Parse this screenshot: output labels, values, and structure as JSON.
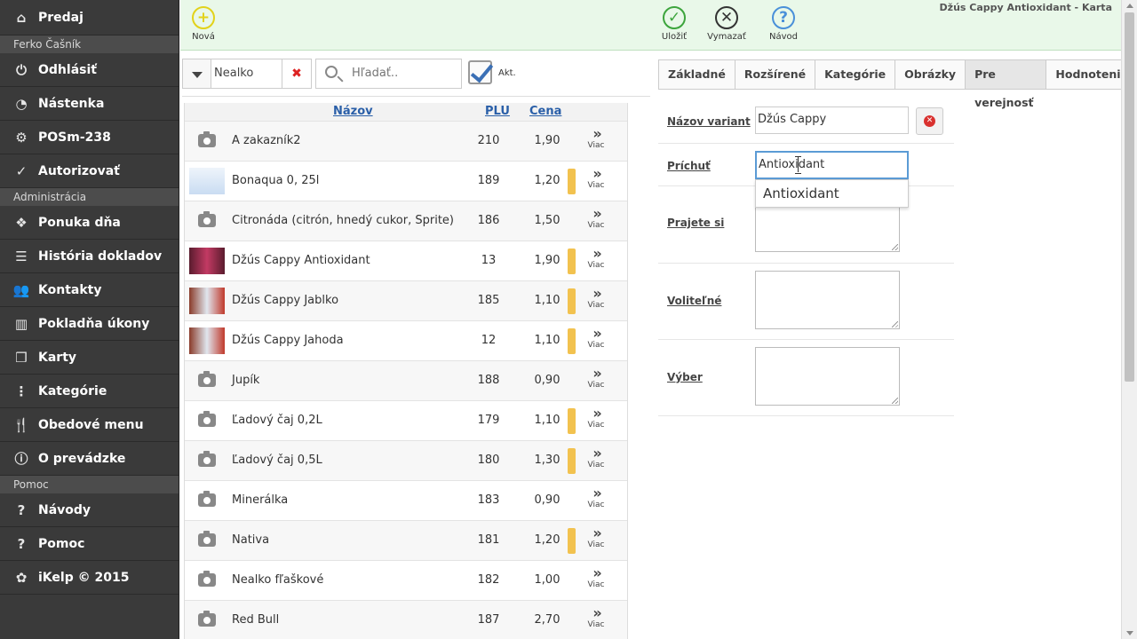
{
  "sidebar": {
    "items": [
      {
        "label": "Predaj",
        "icon": "home-icon",
        "glyph": "⌂"
      },
      {
        "type": "header",
        "label": "Ferko Čašník"
      },
      {
        "label": "Odhlásiť",
        "icon": "power-icon",
        "glyph": "⏻"
      },
      {
        "label": "Nástenka",
        "icon": "dashboard-icon",
        "glyph": "◔"
      },
      {
        "label": "POSm-238",
        "icon": "gear-icon",
        "glyph": "⚙"
      },
      {
        "label": "Autorizovať",
        "icon": "check-circle-icon",
        "glyph": "✓"
      },
      {
        "type": "header",
        "label": "Administrácia"
      },
      {
        "label": "Ponuka dňa",
        "icon": "cubes-star-icon",
        "glyph": "❖"
      },
      {
        "label": "História dokladov",
        "icon": "list-icon",
        "glyph": "☰"
      },
      {
        "label": "Kontakty",
        "icon": "users-icon",
        "glyph": "👥"
      },
      {
        "label": "Pokladňa úkony",
        "icon": "bar-chart-icon",
        "glyph": "▥"
      },
      {
        "label": "Karty",
        "icon": "cubes-icon",
        "glyph": "❒"
      },
      {
        "label": "Kategórie",
        "icon": "tree-icon",
        "glyph": "⋮"
      },
      {
        "label": "Obedové menu",
        "icon": "cutlery-icon",
        "glyph": "🍴"
      },
      {
        "label": "O prevádzke",
        "icon": "info-icon",
        "glyph": "ⓘ"
      },
      {
        "type": "header",
        "label": "Pomoc"
      },
      {
        "label": "Návody",
        "icon": "question-icon",
        "glyph": "?"
      },
      {
        "label": "Pomoc",
        "icon": "question-icon",
        "glyph": "?"
      },
      {
        "label": "iKelp © 2015",
        "icon": "ikelp-logo-icon",
        "glyph": "✿"
      }
    ]
  },
  "toolbar": {
    "new_label": "Nová",
    "save_label": "Uložiť",
    "delete_label": "Vymazať",
    "help_label": "Návod",
    "title": "Džús Cappy Antioxidant - Karta",
    "colors": {
      "new": "#e2d21a",
      "save": "#3da53d",
      "delete": "#333333",
      "help": "#4a90d9"
    }
  },
  "filter": {
    "category_value": "Nealko",
    "search_placeholder": "Hľadať..",
    "active_label": "Akt."
  },
  "table": {
    "headers": {
      "name": "Názov",
      "plu": "PLU",
      "price": "Cena"
    },
    "more_label": "Viac",
    "rows": [
      {
        "name": "A zakazník2",
        "plu": "210",
        "price": "1,90",
        "img": "camera",
        "bar": false
      },
      {
        "name": "Bonaqua 0, 25l",
        "plu": "189",
        "price": "1,20",
        "img": "bonaqua",
        "bar": true
      },
      {
        "name": "Citronáda (citrón, hnedý cukor, Sprite)",
        "plu": "186",
        "price": "1,50",
        "img": "camera",
        "bar": false
      },
      {
        "name": "Džús Cappy Antioxidant",
        "plu": "13",
        "price": "1,90",
        "img": "cappy-dark",
        "bar": true
      },
      {
        "name": "Džús Cappy Jablko",
        "plu": "185",
        "price": "1,10",
        "img": "cappy",
        "bar": true
      },
      {
        "name": "Džús Cappy Jahoda",
        "plu": "12",
        "price": "1,10",
        "img": "cappy",
        "bar": true
      },
      {
        "name": "Jupík",
        "plu": "188",
        "price": "0,90",
        "img": "camera",
        "bar": false
      },
      {
        "name": "Ľadový čaj 0,2L",
        "plu": "179",
        "price": "1,10",
        "img": "camera",
        "bar": true
      },
      {
        "name": "Ľadový čaj 0,5L",
        "plu": "180",
        "price": "1,30",
        "img": "camera",
        "bar": true
      },
      {
        "name": "Minerálka",
        "plu": "183",
        "price": "0,90",
        "img": "camera",
        "bar": false
      },
      {
        "name": "Nativa",
        "plu": "181",
        "price": "1,20",
        "img": "camera",
        "bar": true
      },
      {
        "name": "Nealko fľaškové",
        "plu": "182",
        "price": "1,00",
        "img": "camera",
        "bar": false
      },
      {
        "name": "Red Bull",
        "plu": "187",
        "price": "2,70",
        "img": "camera",
        "bar": false
      }
    ]
  },
  "tabs": [
    {
      "label": "Základné",
      "active": false
    },
    {
      "label": "Rozšírené",
      "active": false
    },
    {
      "label": "Kategórie",
      "active": false
    },
    {
      "label": "Obrázky",
      "active": false
    },
    {
      "label": "Pre verejnosť",
      "active": true
    },
    {
      "label": "Hodnotenie",
      "active": false
    }
  ],
  "form": {
    "variant_label": "Názov variant",
    "variant_value": "Džús Cappy",
    "flavor_label": "Príchuť",
    "flavor_value": "Antioxidant",
    "wish_label": "Prajete si",
    "optional_label": "Voliteľné",
    "choice_label": "Výber",
    "suggestion": "Antioxidant"
  }
}
